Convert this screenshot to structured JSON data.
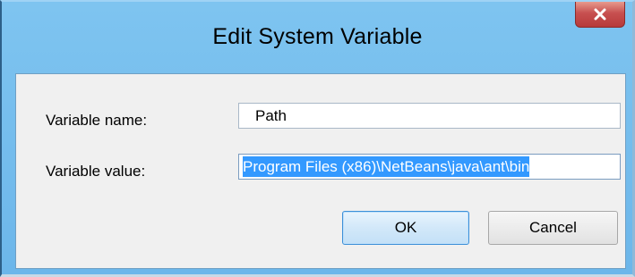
{
  "window": {
    "title": "Edit System Variable",
    "close_icon": "close-icon"
  },
  "form": {
    "name_label": "Variable name:",
    "name_value": "Path",
    "value_label": "Variable value:",
    "value_value": "Program Files (x86)\\NetBeans\\java\\ant\\bin"
  },
  "buttons": {
    "ok_label": "OK",
    "cancel_label": "Cancel"
  },
  "colors": {
    "title_bar": "#7ec4f0",
    "close_button": "#c75050",
    "selection": "#3399ff",
    "dialog_body": "#f0f0f0"
  }
}
